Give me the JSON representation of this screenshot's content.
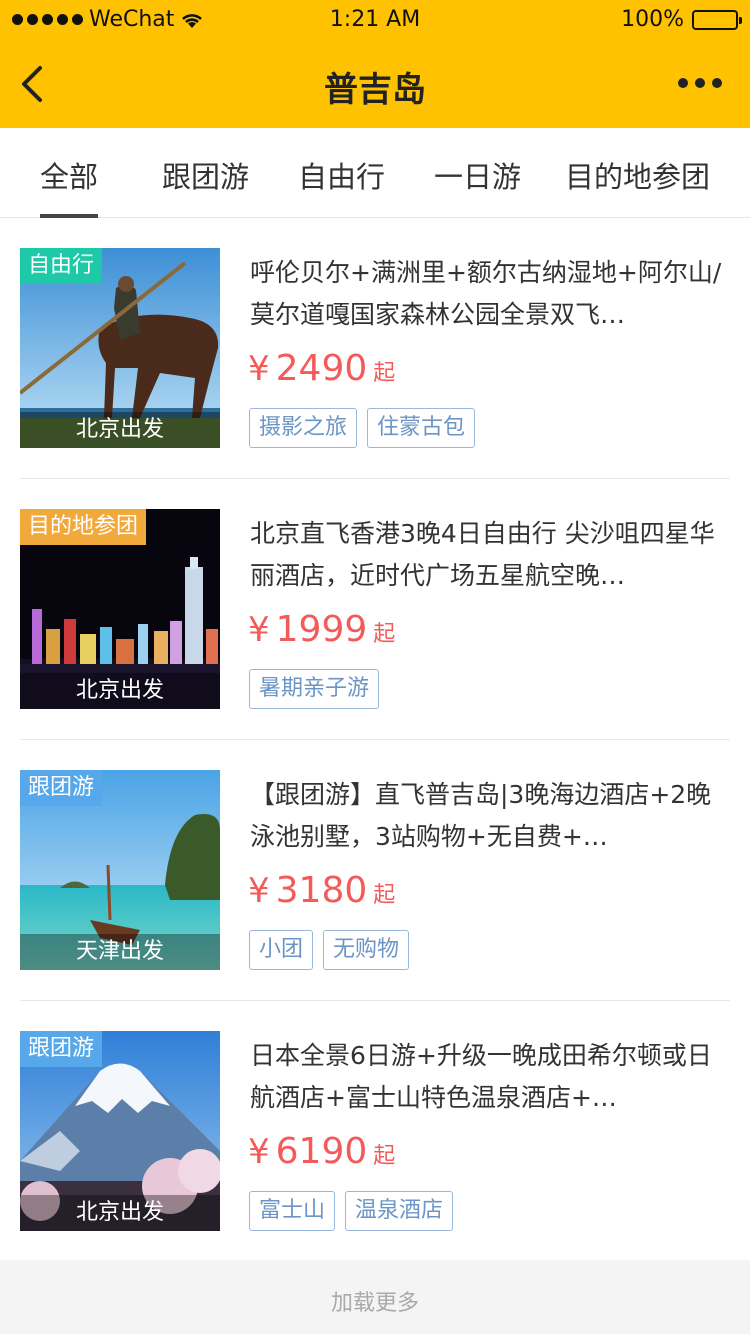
{
  "status": {
    "carrier": "WeChat",
    "time": "1:21 AM",
    "battery": "100%"
  },
  "nav": {
    "title": "普吉岛"
  },
  "tabs": [
    {
      "label": "全部"
    },
    {
      "label": "跟团游"
    },
    {
      "label": "自由行"
    },
    {
      "label": "一日游"
    },
    {
      "label": "目的地参团"
    }
  ],
  "items": [
    {
      "badge": "自由行",
      "badge_color": "#1ec9a7",
      "depart": "北京出发",
      "title": "呼伦贝尔+满洲里+额尔古纳湿地+阿尔山/莫尔道嘎国家森林公园全景双飞…",
      "currency": "¥",
      "price": "2490",
      "suffix": "起",
      "tags": [
        "摄影之旅",
        "住蒙古包"
      ]
    },
    {
      "badge": "目的地参团",
      "badge_color": "#f2a93b",
      "depart": "北京出发",
      "title": "北京直飞香港3晚4日自由行 尖沙咀四星华丽酒店，近时代广场五星航空晚…",
      "currency": "¥",
      "price": "1999",
      "suffix": "起",
      "tags": [
        "暑期亲子游"
      ]
    },
    {
      "badge": "跟团游",
      "badge_color": "#56a8ea",
      "depart": "天津出发",
      "title": "【跟团游】直飞普吉岛|3晚海边酒店+2晚泳池别墅，3站购物+无自费+…",
      "currency": "¥",
      "price": "3180",
      "suffix": "起",
      "tags": [
        "小团",
        "无购物"
      ]
    },
    {
      "badge": "跟团游",
      "badge_color": "#56a8ea",
      "depart": "北京出发",
      "title": "日本全景6日游+升级一晚成田希尔顿或日航酒店+富士山特色温泉酒店+…",
      "currency": "¥",
      "price": "6190",
      "suffix": "起",
      "tags": [
        "富士山",
        "温泉酒店"
      ]
    }
  ],
  "footer": {
    "load_more": "加载更多"
  },
  "colors": {
    "brand": "#ffc200",
    "price": "#f35a58",
    "tag": "#6c95c6"
  }
}
